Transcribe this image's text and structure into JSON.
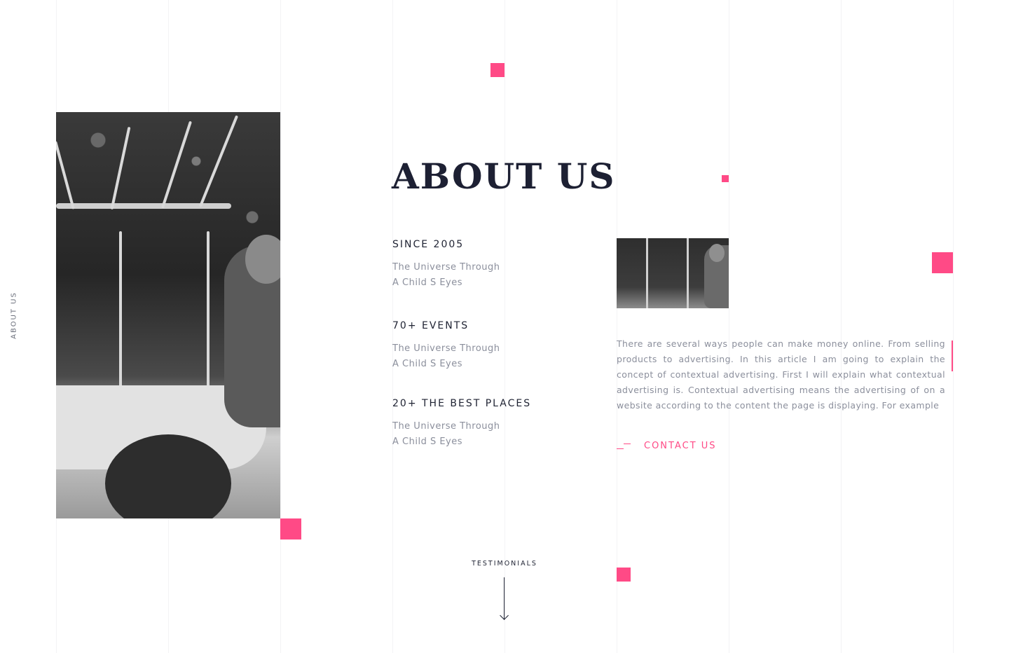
{
  "side_label": "ABOUT US",
  "title": "ABOUT US",
  "stats": [
    {
      "heading": "SINCE 2005",
      "line1": "The Universe Through",
      "line2": "A Child S Eyes"
    },
    {
      "heading": "70+ EVENTS",
      "line1": "The Universe Through",
      "line2": "A Child S Eyes"
    },
    {
      "heading": "20+ THE BEST PLACES",
      "line1": "The Universe Through",
      "line2": "A Child S Eyes"
    }
  ],
  "paragraph": "There are several ways people can make money online. From selling products to advertising. In this article I am going to explain the concept of contextual advertising. First I will explain what contextual advertising is. Contextual advertising means the advertising of on a website according to the content the page is displaying. For example",
  "contact_label": "CONTACT US",
  "testimonials_label": "TESTIMONIALS",
  "colors": {
    "accent": "#ff4a86",
    "heading": "#1d2033",
    "muted": "#8b8f9c",
    "background": "#ffffff"
  }
}
